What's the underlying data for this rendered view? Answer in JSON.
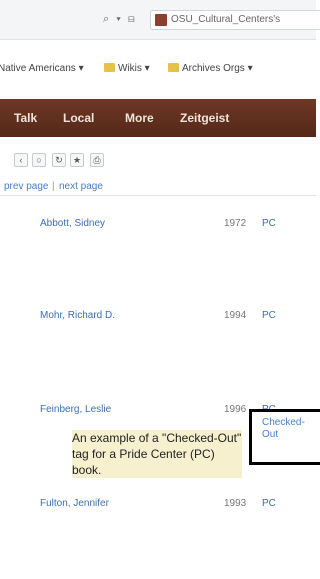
{
  "browser": {
    "address_controls": "⌕ ▾ ⊟",
    "tab_title": "OSU_Cultural_Centers's"
  },
  "bookmarks": [
    {
      "label": "Native Americans ▾"
    },
    {
      "label": "Wikis ▾"
    },
    {
      "label": "Archives Orgs ▾"
    }
  ],
  "nav": {
    "items": [
      {
        "label": "Talk"
      },
      {
        "label": "Local"
      },
      {
        "label": "More"
      },
      {
        "label": "Zeitgeist"
      }
    ]
  },
  "toolbar": {
    "buttons": [
      {
        "glyph": "‹",
        "icon": "back-icon"
      },
      {
        "glyph": "○",
        "icon": "circle-icon"
      },
      {
        "glyph": "↻",
        "icon": "refresh-icon"
      },
      {
        "glyph": "★",
        "icon": "star-icon"
      },
      {
        "glyph": "⎙",
        "icon": "print-icon"
      }
    ]
  },
  "pager": {
    "prev": "prev page",
    "separator": "|",
    "next": "next page"
  },
  "records": [
    {
      "name": "Abbott, Sidney",
      "year": "1972",
      "collection": "PC"
    },
    {
      "name": "Mohr, Richard D.",
      "year": "1994",
      "collection": "PC"
    },
    {
      "name": "Feinberg, Leslie",
      "year": "1996",
      "collection": "PC"
    },
    {
      "name": "Fulton, Jennifer",
      "year": "1993",
      "collection": "PC"
    }
  ],
  "status_tag": "Checked-Out",
  "callout": "An example of a \"Checked-Out\" tag for a Pride Center (PC) book."
}
